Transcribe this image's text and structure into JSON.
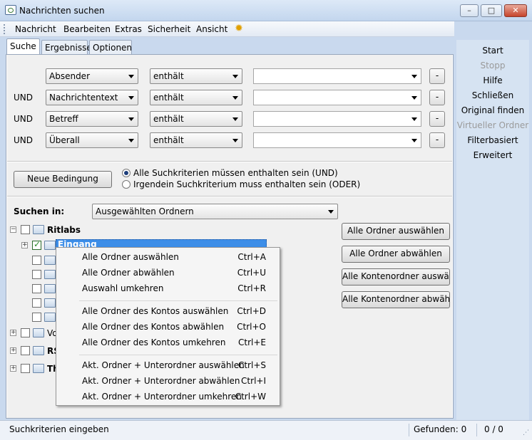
{
  "window": {
    "title": "Nachrichten suchen"
  },
  "menu": [
    "Nachricht",
    "Bearbeiten",
    "Extras",
    "Sicherheit",
    "Ansicht"
  ],
  "tabs": [
    "Suche",
    "Ergebnisse",
    "Optionen"
  ],
  "criteria": [
    {
      "conjunction": "",
      "field": "Absender",
      "operator": "enthält",
      "value": ""
    },
    {
      "conjunction": "UND",
      "field": "Nachrichtentext",
      "operator": "enthält",
      "value": ""
    },
    {
      "conjunction": "UND",
      "field": "Betreff",
      "operator": "enthält",
      "value": ""
    },
    {
      "conjunction": "UND",
      "field": "Überall",
      "operator": "enthält",
      "value": ""
    }
  ],
  "remove_label": "-",
  "new_condition": "Neue Bedingung",
  "match": {
    "all": "Alle Suchkriterien müssen enthalten sein (UND)",
    "any": "Irgendein Suchkriterium muss enthalten sein (ODER)",
    "selected": "all"
  },
  "search_in": {
    "label": "Suchen in:",
    "value": "Ausgewählten Ordnern"
  },
  "tree": {
    "ritlabs": "Ritlabs",
    "inbox": "Eingang",
    "partial": [
      "Vo",
      "RS",
      "Th"
    ]
  },
  "folder_buttons": [
    "Alle Ordner auswählen",
    "Alle Ordner abwählen",
    "Alle Kontenordner auswählen",
    "Alle Kontenordner abwählen"
  ],
  "context_menu": [
    [
      {
        "label": "Alle Ordner auswählen",
        "shortcut": "Ctrl+A"
      },
      {
        "label": "Alle Ordner abwählen",
        "shortcut": "Ctrl+U"
      },
      {
        "label": "Auswahl umkehren",
        "shortcut": "Ctrl+R"
      }
    ],
    [
      {
        "label": "Alle Ordner des Kontos auswählen",
        "shortcut": "Ctrl+D"
      },
      {
        "label": "Alle Ordner des Kontos abwählen",
        "shortcut": "Ctrl+O"
      },
      {
        "label": "Alle Ordner des Kontos umkehren",
        "shortcut": "Ctrl+E"
      }
    ],
    [
      {
        "label": "Akt. Ordner + Unterordner auswählen",
        "shortcut": "Ctrl+S"
      },
      {
        "label": "Akt. Ordner + Unterordner abwählen",
        "shortcut": "Ctrl+I"
      },
      {
        "label": "Akt. Ordner + Unterordner umkehren",
        "shortcut": "Ctrl+W"
      }
    ]
  ],
  "side_panel": [
    {
      "label": "Start",
      "enabled": true
    },
    {
      "label": "Stopp",
      "enabled": false
    },
    {
      "label": "Hilfe",
      "enabled": true
    },
    {
      "label": "Schließen",
      "enabled": true
    },
    {
      "label": "Original finden",
      "enabled": true
    },
    {
      "label": "Virtueller Ordner",
      "enabled": false
    },
    {
      "label": "Filterbasiert",
      "enabled": true
    },
    {
      "label": "Erweitert",
      "enabled": true
    }
  ],
  "status": {
    "message": "Suchkriterien eingeben",
    "found": "Gefunden: 0",
    "count": "0 / 0"
  },
  "colors": {
    "accent": "#3d8ee8",
    "panel": "#d6e3f2",
    "disabled": "#9a9a9a"
  }
}
